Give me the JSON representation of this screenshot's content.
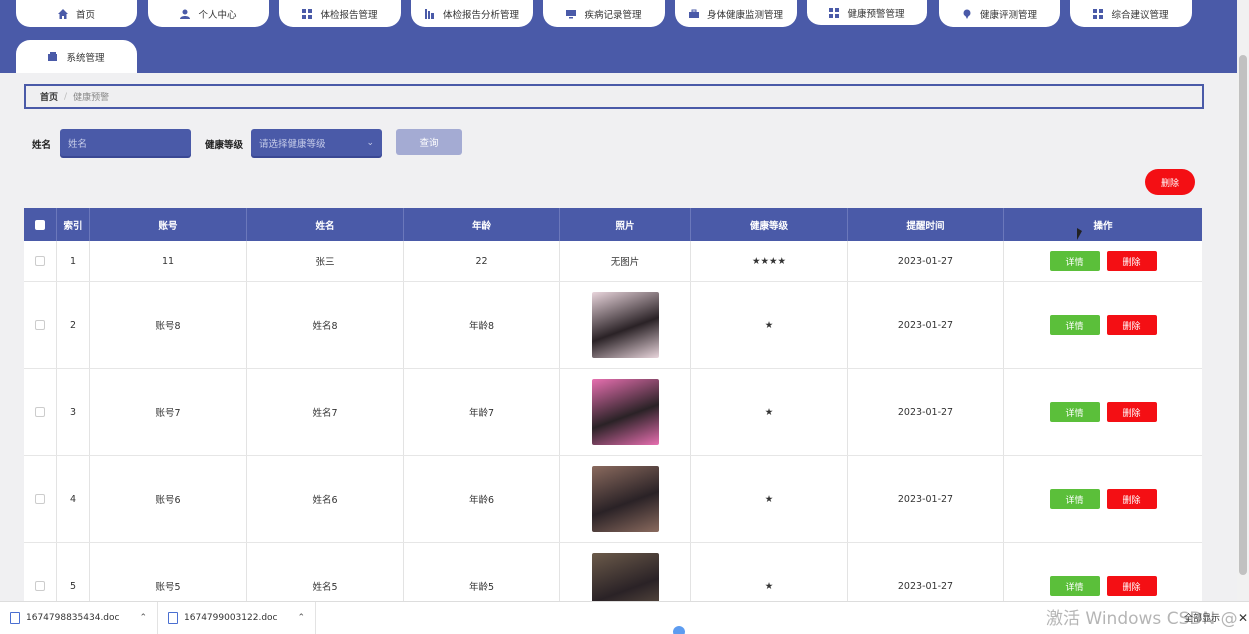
{
  "nav": {
    "tabs_row1": [
      {
        "label": "首页",
        "icon": "home-icon"
      },
      {
        "label": "个人中心",
        "icon": "user-icon"
      },
      {
        "label": "体检报告管理",
        "icon": "grid-icon"
      },
      {
        "label": "体检报告分析管理",
        "icon": "chart-icon"
      },
      {
        "label": "疾病记录管理",
        "icon": "monitor-icon"
      },
      {
        "label": "身体健康监测管理",
        "icon": "briefcase-icon"
      },
      {
        "label": "健康预警管理",
        "icon": "grid-icon"
      },
      {
        "label": "健康评测管理",
        "icon": "pin-icon"
      },
      {
        "label": "综合建议管理",
        "icon": "grid-icon"
      }
    ],
    "tab_row2": {
      "label": "系统管理",
      "icon": "wallet-icon"
    }
  },
  "breadcrumb": {
    "home": "首页",
    "current": "健康预警"
  },
  "search": {
    "name_label": "姓名",
    "name_placeholder": "姓名",
    "level_label": "健康等级",
    "level_placeholder": "请选择健康等级",
    "query_button": "查询"
  },
  "delete_button": "删除",
  "table": {
    "headers": [
      "索引",
      "账号",
      "姓名",
      "年龄",
      "照片",
      "健康等级",
      "提醒时间",
      "操作"
    ],
    "rows": [
      {
        "index": "1",
        "account": "11",
        "name": "张三",
        "age": "22",
        "photo": "无图片",
        "level": "★★★★",
        "time": "2023-01-27",
        "has_photo": false
      },
      {
        "index": "2",
        "account": "账号8",
        "name": "姓名8",
        "age": "年龄8",
        "photo": "",
        "level": "★",
        "time": "2023-01-27",
        "has_photo": true,
        "photo_color": "#e9d5dc"
      },
      {
        "index": "3",
        "account": "账号7",
        "name": "姓名7",
        "age": "年龄7",
        "photo": "",
        "level": "★",
        "time": "2023-01-27",
        "has_photo": true,
        "photo_color": "#e76fb0"
      },
      {
        "index": "4",
        "account": "账号6",
        "name": "姓名6",
        "age": "年龄6",
        "photo": "",
        "level": "★",
        "time": "2023-01-27",
        "has_photo": true,
        "photo_color": "#8a6a5e"
      },
      {
        "index": "5",
        "account": "账号5",
        "name": "姓名5",
        "age": "年龄5",
        "photo": "",
        "level": "★",
        "time": "2023-01-27",
        "has_photo": true,
        "photo_color": "#6b5a4a"
      }
    ],
    "detail_button": "详情",
    "delete_button": "删除"
  },
  "downloads": {
    "items": [
      "1674798835434.doc",
      "1674799003122.doc"
    ],
    "show_all": "全部显示"
  },
  "watermark": "激活 Windows CSDN @李子"
}
